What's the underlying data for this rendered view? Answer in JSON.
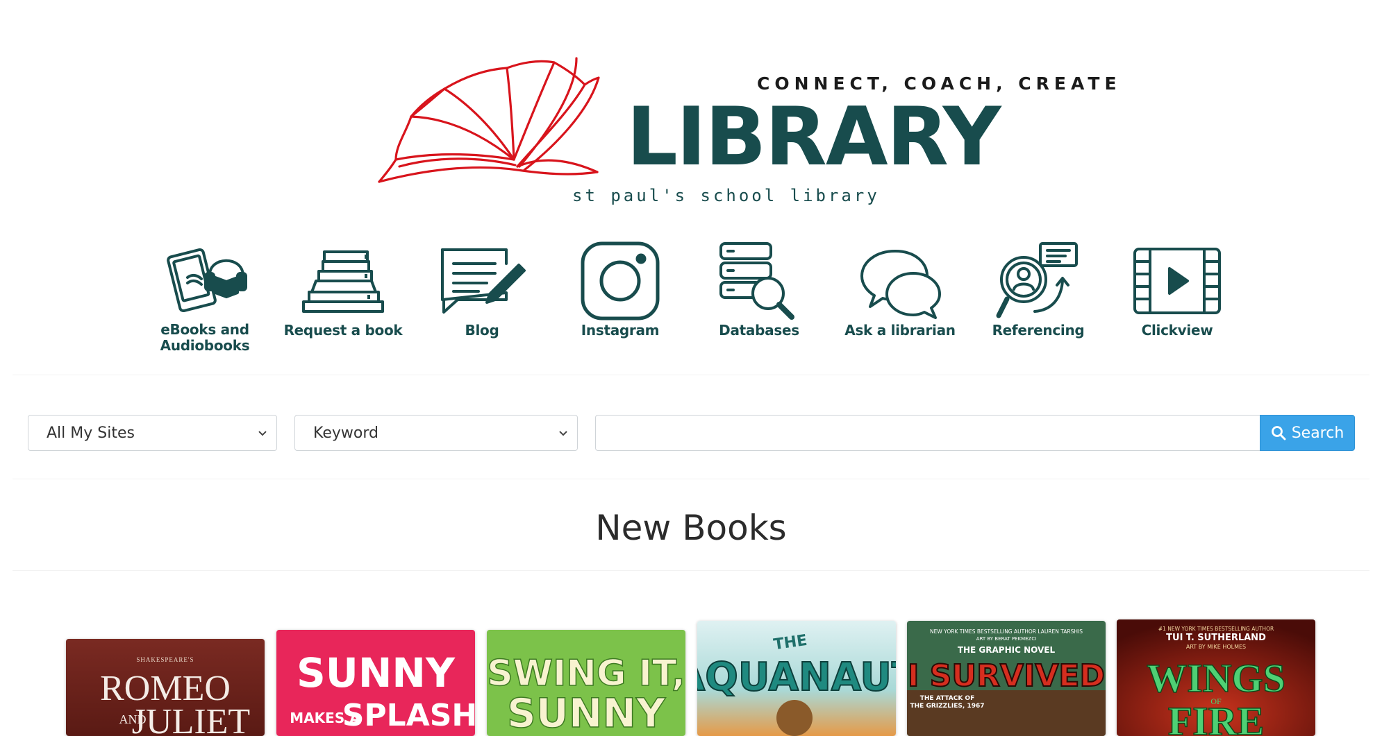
{
  "logo": {
    "tagline": "CONNECT, COACH, CREATE",
    "word": "LIBRARY",
    "subtitle": "st paul's school library"
  },
  "quick_links": [
    {
      "label": "eBooks and Audiobooks",
      "icon": "ebook-audiobook-icon"
    },
    {
      "label": "Request a book",
      "icon": "book-stack-icon"
    },
    {
      "label": "Blog",
      "icon": "blog-icon"
    },
    {
      "label": "Instagram",
      "icon": "instagram-icon"
    },
    {
      "label": "Databases",
      "icon": "database-search-icon"
    },
    {
      "label": "Ask a librarian",
      "icon": "chat-bubbles-icon"
    },
    {
      "label": "Referencing",
      "icon": "referencing-icon"
    },
    {
      "label": "Clickview",
      "icon": "video-player-icon"
    }
  ],
  "search": {
    "site_select": "All My Sites",
    "type_select": "Keyword",
    "query": "",
    "button_label": "Search"
  },
  "new_books": {
    "title": "New Books",
    "books": [
      {
        "title": "ROMEO AND JULIET",
        "cover_text": [
          "SHAKESPEARE'S",
          "ROMEO",
          "AND",
          "JULIET"
        ]
      },
      {
        "title": "SUNNY MAKES A SPLASH",
        "cover_text": [
          "SUNNY",
          "MAKES A",
          "SPLASH"
        ]
      },
      {
        "title": "SWING IT, SUNNY",
        "cover_text": [
          "SWING IT,",
          "SUNNY"
        ]
      },
      {
        "title": "THE AQUANAUT",
        "cover_text": [
          "THE",
          "AQUANAUT"
        ]
      },
      {
        "title": "I SURVIVED",
        "cover_text": [
          "NEW YORK TIMES BESTSELLING AUTHOR LAUREN TARSHIS",
          "ART BY BERAT PEKMEZCI",
          "THE GRAPHIC NOVEL",
          "I SURVIVED",
          "THE ATTACK OF",
          "THE GRIZZLIES, 1967"
        ]
      },
      {
        "title": "WINGS OF FIRE",
        "cover_text": [
          "#1 NEW YORK TIMES BESTSELLING AUTHOR",
          "TUI T. SUTHERLAND",
          "ART BY MIKE HOLMES",
          "WINGS",
          "OF",
          "FIRE"
        ]
      }
    ]
  },
  "colors": {
    "brand_teal": "#184c4d",
    "logo_red": "#d8141c",
    "search_button": "#3aa3e8"
  }
}
